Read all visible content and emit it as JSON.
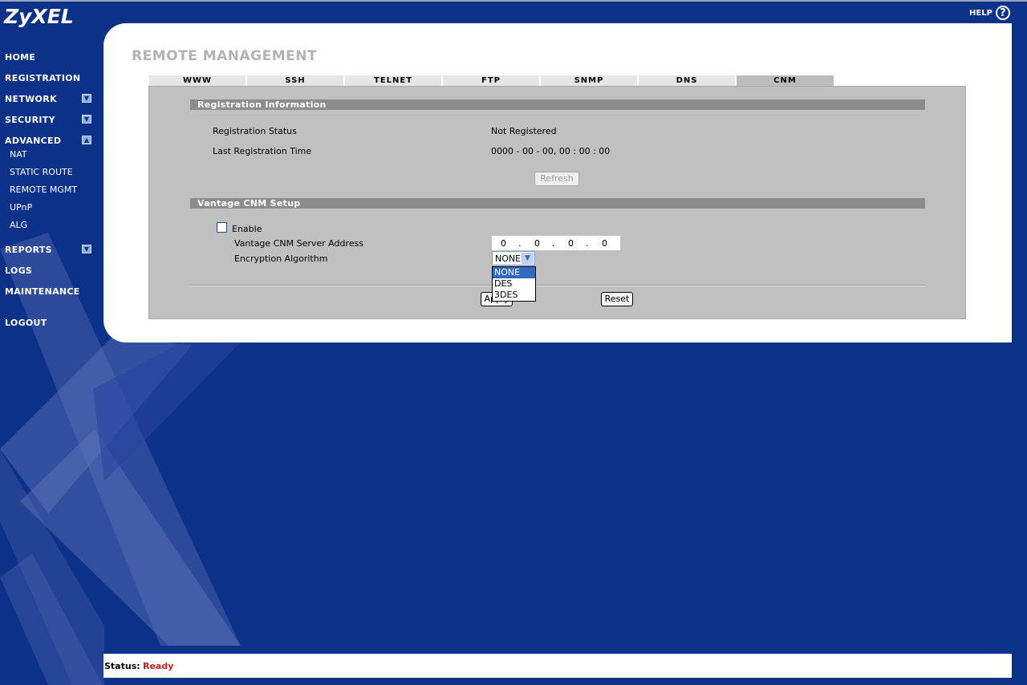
{
  "brand": {
    "logo": "ZyXEL",
    "help_label": "HELP",
    "help_icon": "question-circle-icon"
  },
  "nav": {
    "items": [
      {
        "label": "HOME"
      },
      {
        "label": "REGISTRATION"
      },
      {
        "label": "NETWORK",
        "icon": "chevron-down-icon"
      },
      {
        "label": "SECURITY",
        "icon": "chevron-down-icon"
      },
      {
        "label": "ADVANCED",
        "icon": "chevron-up-icon"
      },
      {
        "label": "REPORTS",
        "icon": "chevron-down-icon"
      },
      {
        "label": "LOGS"
      },
      {
        "label": "MAINTENANCE"
      },
      {
        "label": "LOGOUT"
      }
    ],
    "advanced_sub": [
      "NAT",
      "STATIC ROUTE",
      "REMOTE MGMT",
      "UPnP",
      "ALG"
    ]
  },
  "page": {
    "title": "REMOTE MANAGEMENT"
  },
  "tabs": [
    "WWW",
    "SSH",
    "TELNET",
    "FTP",
    "SNMP",
    "DNS",
    "CNM"
  ],
  "active_tab": "CNM",
  "registration": {
    "header": "Registration Information",
    "status_label": "Registration Status",
    "status_value": "Not Registered",
    "last_time_label": "Last Registration Time",
    "last_time_value": "0000 - 00 - 00, 00 : 00 : 00",
    "refresh_label": "Refresh"
  },
  "cnm_setup": {
    "header": "Vantage CNM Setup",
    "enable_label": "Enable",
    "enable_checked": false,
    "server_label": "Vantage CNM Server Address",
    "ip": [
      "0",
      "0",
      "0",
      "0"
    ],
    "ip_sep": ".",
    "encryption_label": "Encryption Algorithm",
    "encryption_value": "NONE",
    "encryption_options": [
      "NONE",
      "DES",
      "3DES"
    ]
  },
  "actions": {
    "apply_label": "Apply",
    "reset_label": "Reset"
  },
  "status": {
    "key": "Status:",
    "value": "Ready"
  },
  "colors": {
    "background": "#0b3189",
    "section_header": "#8c8c8c",
    "content_bg": "#c0c0c0",
    "status_ready": "#d31a1a",
    "dropdown_selected": "#316ac5"
  }
}
